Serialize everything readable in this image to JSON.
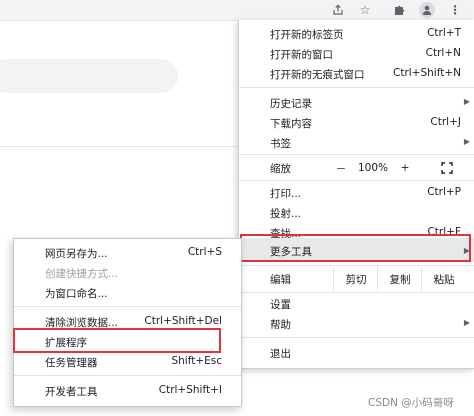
{
  "menu": {
    "new_tab": {
      "label": "打开新的标签页",
      "shortcut": "Ctrl+T"
    },
    "new_window": {
      "label": "打开新的窗口",
      "shortcut": "Ctrl+N"
    },
    "incognito": {
      "label": "打开新的无痕式窗口",
      "shortcut": "Ctrl+Shift+N"
    },
    "history": {
      "label": "历史记录"
    },
    "downloads": {
      "label": "下载内容",
      "shortcut": "Ctrl+J"
    },
    "bookmarks": {
      "label": "书签"
    },
    "zoom": {
      "label": "缩放",
      "minus": "－",
      "value": "100%",
      "plus": "+"
    },
    "print": {
      "label": "打印...",
      "shortcut": "Ctrl+P"
    },
    "cast": {
      "label": "投射..."
    },
    "find": {
      "label": "查找...",
      "shortcut": "Ctrl+F"
    },
    "more_tools": {
      "label": "更多工具"
    },
    "edit": {
      "label": "编辑",
      "cut": "剪切",
      "copy": "复制",
      "paste": "粘贴"
    },
    "settings": {
      "label": "设置"
    },
    "help": {
      "label": "帮助"
    },
    "exit": {
      "label": "退出"
    }
  },
  "submenu": {
    "save_page": {
      "label": "网页另存为...",
      "shortcut": "Ctrl+S"
    },
    "create_shortcut": {
      "label": "创建快捷方式..."
    },
    "name_window": {
      "label": "为窗口命名..."
    },
    "clear_data": {
      "label": "清除浏览数据...",
      "shortcut": "Ctrl+Shift+Del"
    },
    "extensions": {
      "label": "扩展程序"
    },
    "task_manager": {
      "label": "任务管理器",
      "shortcut": "Shift+Esc"
    },
    "dev_tools": {
      "label": "开发者工具",
      "shortcut": "Ctrl+Shift+I"
    }
  },
  "watermark": "CSDN @小码哥呀",
  "colors": {
    "highlight": "#d9363e",
    "hover": "#e8e8e8"
  }
}
